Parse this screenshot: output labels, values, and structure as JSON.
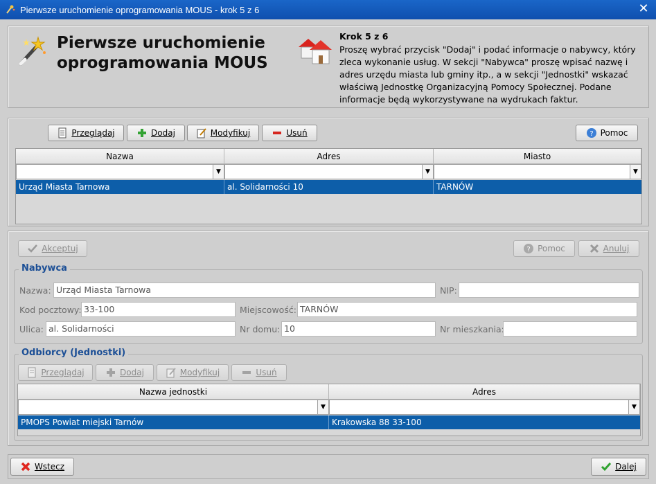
{
  "window": {
    "title": "Pierwsze uruchomienie oprogramowania MOUS - krok 5 z 6",
    "close_glyph": "✕"
  },
  "header": {
    "title": "Pierwsze uruchomienie oprogramowania MOUS",
    "step_title": "Krok 5 z 6",
    "step_text": "Proszę wybrać przycisk \"Dodaj\" i podać informacje o nabywcy, który zleca wykonanie usług. W sekcji \"Nabywca\" proszę wpisać nazwę i adres urzędu miasta lub gminy itp., a w sekcji \"Jednostki\" wskazać właściwą Jednostkę Organizacyjną Pomocy Społecznej. Podane informacje będą wykorzystywane na wydrukach faktur."
  },
  "toolbar": {
    "browse": "Przeglądaj",
    "add": "Dodaj",
    "modify": "Modyfikuj",
    "delete": "Usuń",
    "help": "Pomoc"
  },
  "grid_top": {
    "columns": [
      "Nazwa",
      "Adres",
      "Miasto"
    ],
    "rows": [
      [
        "Urząd Miasta Tarnowa",
        "al. Solidarności 10",
        "TARNÓW"
      ]
    ]
  },
  "edit_toolbar": {
    "accept": "Akceptuj",
    "help": "Pomoc",
    "cancel": "Anuluj"
  },
  "nabywca": {
    "group_label": "Nabywca",
    "name_label": "Nazwa:",
    "name_value": "Urząd Miasta Tarnowa",
    "nip_label": "NIP:",
    "nip_value": "",
    "postal_label": "Kod pocztowy:",
    "postal_value": "33-100",
    "city_label": "Miejscowość:",
    "city_value": "TARNÓW",
    "street_label": "Ulica:",
    "street_value": "al. Solidarności",
    "house_label": "Nr domu:",
    "house_value": "10",
    "flat_label": "Nr mieszkania:",
    "flat_value": ""
  },
  "odbiorcy": {
    "group_label": "Odbiorcy (Jednostki)",
    "browse": "Przeglądaj",
    "add": "Dodaj",
    "modify": "Modyfikuj",
    "delete": "Usuń",
    "columns": [
      "Nazwa jednostki",
      "Adres"
    ],
    "rows": [
      [
        "PMOPS Powiat miejski Tarnów",
        "Krakowska 88 33-100"
      ]
    ]
  },
  "footer": {
    "back": "Wstecz",
    "next": "Dalej"
  },
  "colors": {
    "titlebar": "#1a66c8",
    "selection": "#0d5ea9",
    "group_label": "#1c4f96"
  }
}
